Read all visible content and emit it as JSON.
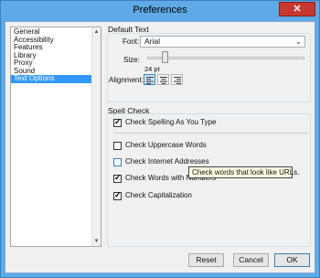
{
  "window": {
    "title": "Preferences",
    "close_label": "✕"
  },
  "sidebar": {
    "items": [
      {
        "label": "General",
        "selected": false
      },
      {
        "label": "Accessibility",
        "selected": false
      },
      {
        "label": "Features",
        "selected": false
      },
      {
        "label": "Library",
        "selected": false
      },
      {
        "label": "Proxy",
        "selected": false
      },
      {
        "label": "Sound",
        "selected": false
      },
      {
        "label": "Text Options",
        "selected": true
      }
    ]
  },
  "default_text": {
    "title": "Default Text",
    "font_label": "Font:",
    "font_value": "Arial",
    "size_label": "Size:",
    "size_value": "24 pt",
    "alignment_label": "Alignment:",
    "alignment_selected": "left"
  },
  "spell_check": {
    "title": "Spell Check",
    "options": [
      {
        "label": "Check Spelling As You Type",
        "checked": true
      },
      {
        "label": "Check Uppercase Words",
        "checked": false
      },
      {
        "label": "Check Internet Addresses",
        "checked": false
      },
      {
        "label": "Check Words with Numbers",
        "checked": true
      },
      {
        "label": "Check Capitalization",
        "checked": true
      }
    ]
  },
  "tooltip": "Check words that look like URLs.",
  "buttons": {
    "reset": "Reset",
    "cancel": "Cancel",
    "ok": "OK"
  }
}
